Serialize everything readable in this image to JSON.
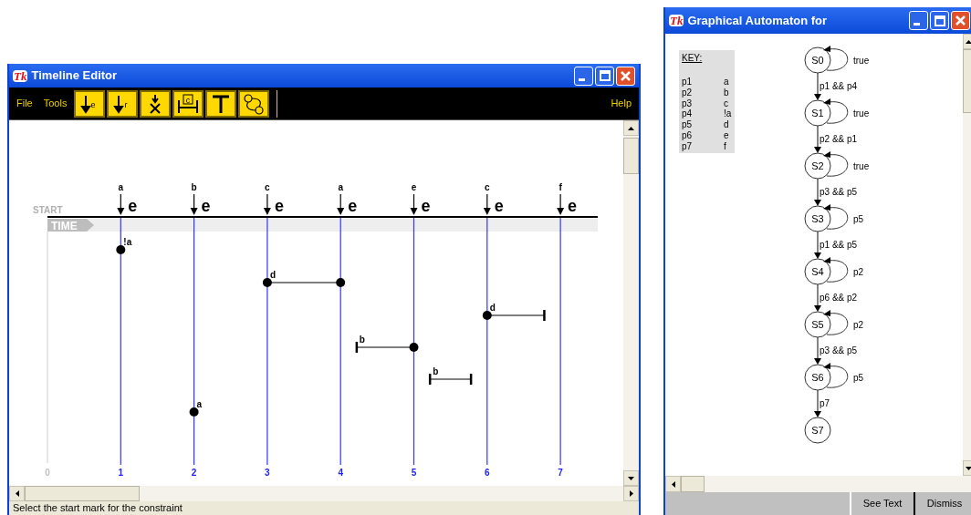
{
  "timeline_window": {
    "logo": "Tk",
    "title": "Timeline Editor",
    "menu": [
      "File",
      "Tools"
    ],
    "help": "Help",
    "tools": [
      {
        "kind": "event",
        "letter": "e"
      },
      {
        "kind": "event",
        "letter": "r"
      },
      {
        "kind": "cross"
      },
      {
        "kind": "constraint",
        "letter": "c"
      },
      {
        "kind": "tee"
      },
      {
        "kind": "cycle"
      }
    ],
    "start_label": "START",
    "band_label": "TIME",
    "origin_tick": "0",
    "events": [
      {
        "label": "a",
        "marker": "e",
        "tick": "1"
      },
      {
        "label": "b",
        "marker": "e",
        "tick": "2"
      },
      {
        "label": "c",
        "marker": "e",
        "tick": "3"
      },
      {
        "label": "a",
        "marker": "e",
        "tick": "4"
      },
      {
        "label": "e",
        "marker": "e",
        "tick": "5"
      },
      {
        "label": "c",
        "marker": "e",
        "tick": "6"
      },
      {
        "label": "f",
        "marker": "e",
        "tick": "7"
      }
    ],
    "constraints": [
      {
        "kind": "point",
        "label": "!a"
      },
      {
        "kind": "dot-dot",
        "label": "d"
      },
      {
        "kind": "dot-bar",
        "label": "d"
      },
      {
        "kind": "bar-dot",
        "label": "b"
      },
      {
        "kind": "bar-bar",
        "label": "b"
      },
      {
        "kind": "point",
        "label": "a"
      }
    ],
    "status_bar": "Select the start mark for the constraint"
  },
  "automaton_window": {
    "logo": "Tk",
    "title": "Graphical Automaton for",
    "key_heading": "KEY:",
    "key": [
      {
        "prop": "p1",
        "value": "a"
      },
      {
        "prop": "p2",
        "value": "b"
      },
      {
        "prop": "p3",
        "value": "c"
      },
      {
        "prop": "p4",
        "value": "!a"
      },
      {
        "prop": "p5",
        "value": "d"
      },
      {
        "prop": "p6",
        "value": "e"
      },
      {
        "prop": "p7",
        "value": "f"
      }
    ],
    "states": [
      {
        "name": "S0",
        "loop": "true"
      },
      {
        "name": "S1",
        "loop": "true"
      },
      {
        "name": "S2",
        "loop": "true"
      },
      {
        "name": "S3",
        "loop": "p5"
      },
      {
        "name": "S4",
        "loop": "p2"
      },
      {
        "name": "S5",
        "loop": "p2"
      },
      {
        "name": "S6",
        "loop": "p5"
      },
      {
        "name": "S7"
      }
    ],
    "transitions": [
      "p1 && p4",
      "p2 && p1",
      "p3 && p5",
      "p1 && p5",
      "p6 && p2",
      "p3 && p5",
      "p7"
    ],
    "buttons": [
      "See Text",
      "Dismiss"
    ]
  }
}
